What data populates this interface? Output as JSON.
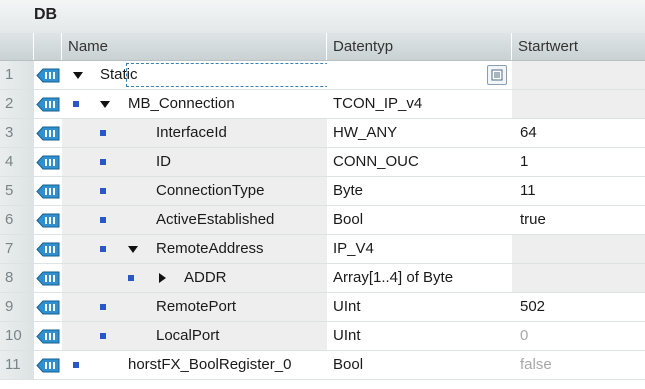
{
  "title": "DB",
  "columns": {
    "name": "Name",
    "datatype": "Datentyp",
    "startvalue": "Startwert"
  },
  "rows": [
    {
      "num": "1",
      "name": "Static",
      "type": "",
      "start": ""
    },
    {
      "num": "2",
      "name": "MB_Connection",
      "type": "TCON_IP_v4",
      "start": ""
    },
    {
      "num": "3",
      "name": "InterfaceId",
      "type": "HW_ANY",
      "start": "64"
    },
    {
      "num": "4",
      "name": "ID",
      "type": "CONN_OUC",
      "start": "1"
    },
    {
      "num": "5",
      "name": "ConnectionType",
      "type": "Byte",
      "start": "11"
    },
    {
      "num": "6",
      "name": "ActiveEstablished",
      "type": "Bool",
      "start": "true"
    },
    {
      "num": "7",
      "name": "RemoteAddress",
      "type": "IP_V4",
      "start": ""
    },
    {
      "num": "8",
      "name": "ADDR",
      "type": "Array[1..4] of Byte",
      "start": ""
    },
    {
      "num": "9",
      "name": "RemotePort",
      "type": "UInt",
      "start": "502"
    },
    {
      "num": "10",
      "name": "LocalPort",
      "type": "UInt",
      "start": "0"
    },
    {
      "num": "11",
      "name": "horstFX_BoolRegister_0",
      "type": "Bool",
      "start": "false"
    }
  ],
  "icons": {
    "row": "interface-tag-icon",
    "bullet": "square-bullet-icon",
    "picker": "list-picker-icon"
  },
  "colors": {
    "accent": "#2a56c6",
    "icon_blue": "#2f8fd0",
    "focus": "#3c7fb1"
  }
}
